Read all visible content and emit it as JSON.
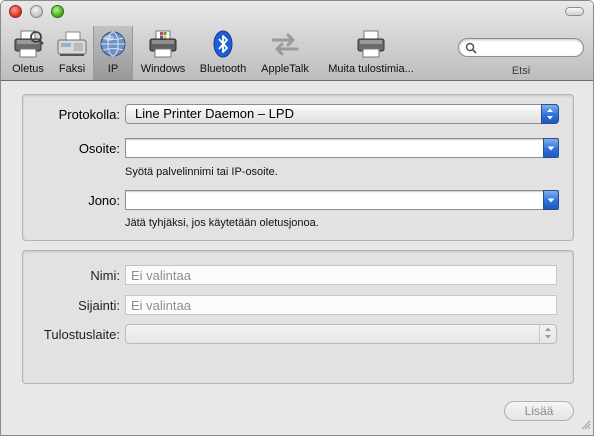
{
  "toolbar": {
    "items": [
      {
        "label": "Oletus",
        "icon": "printer-default-icon"
      },
      {
        "label": "Faksi",
        "icon": "fax-icon"
      },
      {
        "label": "IP",
        "icon": "ip-globe-icon",
        "selected": true
      },
      {
        "label": "Windows",
        "icon": "windows-printer-icon"
      },
      {
        "label": "Bluetooth",
        "icon": "bluetooth-icon"
      },
      {
        "label": "AppleTalk",
        "icon": "appletalk-icon"
      },
      {
        "label": "Muita tulostimia...",
        "icon": "more-printers-icon"
      }
    ],
    "search": {
      "placeholder": "",
      "label": "Etsi"
    }
  },
  "connection": {
    "protocol": {
      "label": "Protokolla:",
      "value": "Line Printer Daemon – LPD"
    },
    "address": {
      "label": "Osoite:",
      "value": "",
      "hint": "Syötä palvelinnimi tai IP-osoite."
    },
    "queue": {
      "label": "Jono:",
      "value": "",
      "hint": "Jätä tyhjäksi, jos käytetään oletusjonoa."
    }
  },
  "printer_info": {
    "name": {
      "label": "Nimi:",
      "placeholder": "Ei valintaa"
    },
    "location": {
      "label": "Sijainti:",
      "placeholder": "Ei valintaa"
    },
    "print_using": {
      "label": "Tulostuslaite:",
      "value": ""
    }
  },
  "footer": {
    "add_label": "Lisää"
  },
  "colors": {
    "accent": "#2f6fdc",
    "toolbar_bg": "#c8c8c8",
    "window_bg": "#e8e8e8"
  }
}
